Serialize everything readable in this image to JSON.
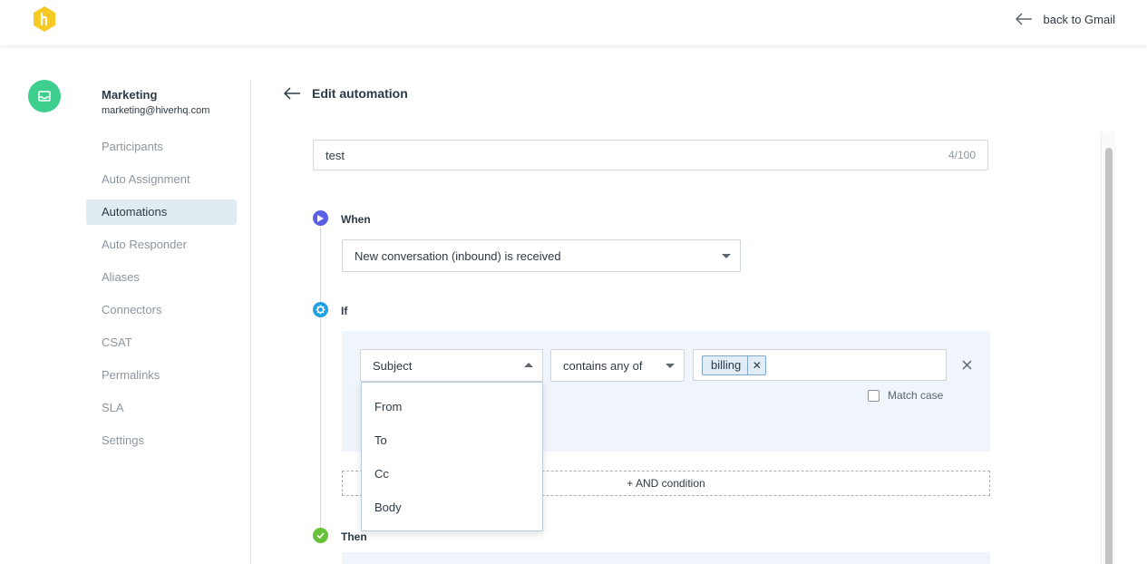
{
  "header": {
    "back_label": "back to Gmail"
  },
  "sidebar": {
    "inbox_name": "Marketing",
    "inbox_email": "marketing@hiverhq.com",
    "items": [
      {
        "label": "Participants"
      },
      {
        "label": "Auto Assignment"
      },
      {
        "label": "Automations",
        "active": true
      },
      {
        "label": "Auto Responder"
      },
      {
        "label": "Aliases"
      },
      {
        "label": "Connectors"
      },
      {
        "label": "CSAT"
      },
      {
        "label": "Permalinks"
      },
      {
        "label": "SLA"
      },
      {
        "label": "Settings"
      }
    ]
  },
  "main": {
    "title": "Edit automation",
    "name_value": "test",
    "name_count": "4/100",
    "when": {
      "label": "When",
      "trigger": "New conversation (inbound) is received"
    },
    "if": {
      "label": "If",
      "field": "Subject",
      "operator": "contains any of",
      "tags": [
        "billing"
      ],
      "match_case_label": "Match case",
      "match_case_checked": false
    },
    "and_condition_label": "+ AND condition",
    "then": {
      "label": "Then"
    },
    "field_dropdown": {
      "options": [
        "From",
        "To",
        "Cc",
        "Body"
      ]
    }
  },
  "colors": {
    "when_icon": "#5b5fe8",
    "if_icon": "#1ea2e3",
    "then_icon": "#67c23a",
    "avatar": "#3ecf8e",
    "logo": "#f7c925",
    "active_nav_bg": "#e1ecf2",
    "panel_bg": "#f0f5fb"
  }
}
